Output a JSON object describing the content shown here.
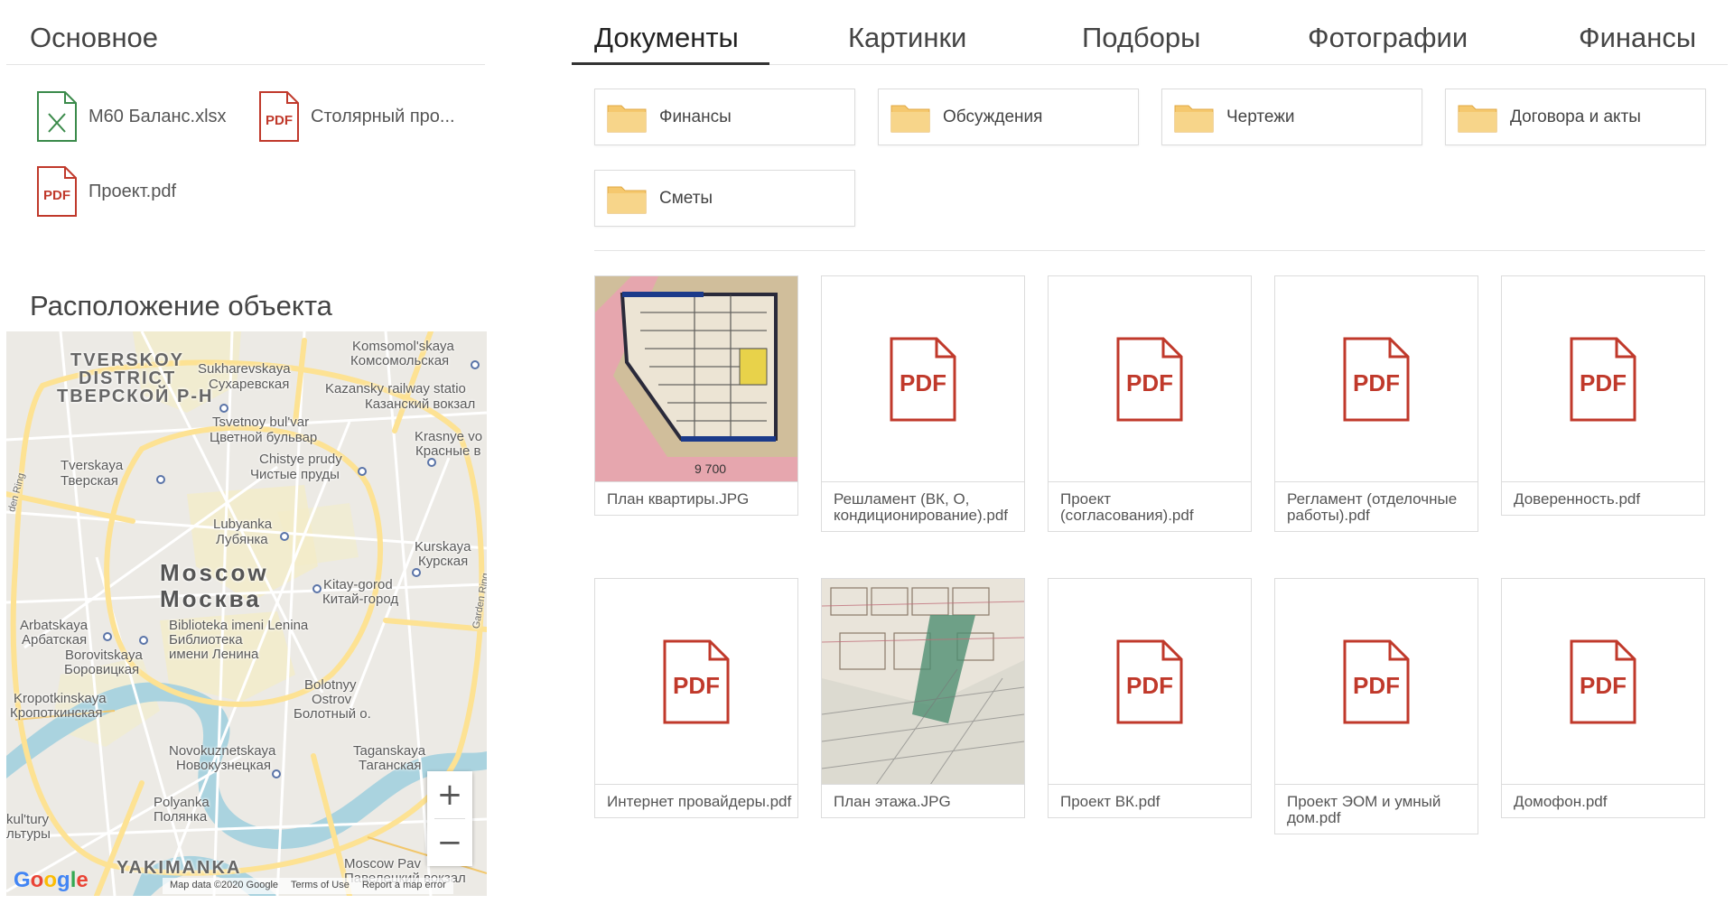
{
  "left": {
    "main_title": "Основное",
    "quick_files": [
      {
        "name": "М60 Баланс.xlsx",
        "type": "xlsx",
        "badge": ""
      },
      {
        "name": "Столярный про...",
        "type": "pdf",
        "badge": "PDF"
      },
      {
        "name": "Проект.pdf",
        "type": "pdf",
        "badge": "PDF"
      }
    ],
    "location_title": "Расположение объекта"
  },
  "map": {
    "labels": [
      {
        "text": "TVERSKOY",
        "kind": "district"
      },
      {
        "text": "DISTRICT",
        "kind": "district"
      },
      {
        "text": "ТВЕРСКОЙ Р-Н",
        "kind": "district"
      },
      {
        "text": "Sukharevskaya",
        "kind": "station"
      },
      {
        "text": "Сухаревская",
        "kind": "station"
      },
      {
        "text": "Komsomol'skaya",
        "kind": "station"
      },
      {
        "text": "Комсомольская",
        "kind": "station"
      },
      {
        "text": "Kazansky railway statio",
        "kind": "station"
      },
      {
        "text": "Казанский вокзал",
        "kind": "station"
      },
      {
        "text": "Tsvetnoy bul'var",
        "kind": "station"
      },
      {
        "text": "Цветной бульвар",
        "kind": "station"
      },
      {
        "text": "Chistye prudy",
        "kind": "station"
      },
      {
        "text": "Чистые пруды",
        "kind": "station"
      },
      {
        "text": "Krasnye vo",
        "kind": "station"
      },
      {
        "text": "Красные в",
        "kind": "station"
      },
      {
        "text": "Tverskaya",
        "kind": "station"
      },
      {
        "text": "Тверская",
        "kind": "station"
      },
      {
        "text": "Lubyanka",
        "kind": "station"
      },
      {
        "text": "Лубянка",
        "kind": "station"
      },
      {
        "text": "Kurskaya",
        "kind": "station"
      },
      {
        "text": "Курская",
        "kind": "station"
      },
      {
        "text": "Moscow",
        "kind": "city"
      },
      {
        "text": "Москва",
        "kind": "city"
      },
      {
        "text": "Kitay-gorod",
        "kind": "station"
      },
      {
        "text": "Китай-город",
        "kind": "station"
      },
      {
        "text": "Arbatskaya",
        "kind": "station"
      },
      {
        "text": "Арбатская",
        "kind": "station"
      },
      {
        "text": "Biblioteka imeni Lenina",
        "kind": "station"
      },
      {
        "text": "Библиотека",
        "kind": "station"
      },
      {
        "text": "имени Ленина",
        "kind": "station"
      },
      {
        "text": "Borovitskaya",
        "kind": "station"
      },
      {
        "text": "Боровицкая",
        "kind": "station"
      },
      {
        "text": "Kropotkinskaya",
        "kind": "station"
      },
      {
        "text": "Кропоткинская",
        "kind": "station"
      },
      {
        "text": "Bolotnyy",
        "kind": "place"
      },
      {
        "text": "Ostrov",
        "kind": "place"
      },
      {
        "text": "Болотный о.",
        "kind": "place"
      },
      {
        "text": "Novokuznetskaya",
        "kind": "station"
      },
      {
        "text": "Новокузнецкая",
        "kind": "station"
      },
      {
        "text": "Taganskaya",
        "kind": "station"
      },
      {
        "text": "Таганская",
        "kind": "station"
      },
      {
        "text": "Polyanka",
        "kind": "station"
      },
      {
        "text": "Полянка",
        "kind": "station"
      },
      {
        "text": "YAKIMANKA",
        "kind": "district"
      },
      {
        "text": "Moscow Pav",
        "kind": "station"
      },
      {
        "text": "Павелецкий вокзал",
        "kind": "station"
      },
      {
        "text": "Garden Ring",
        "kind": "road"
      },
      {
        "text": "den Ring",
        "kind": "road"
      },
      {
        "text": "kul'tury",
        "kind": "station"
      },
      {
        "text": "льтуры",
        "kind": "station"
      }
    ],
    "zoom_in": "+",
    "zoom_out": "−",
    "google": [
      "G",
      "o",
      "o",
      "g",
      "l",
      "e"
    ],
    "footer": [
      "Map data ©2020 Google",
      "Terms of Use",
      "Report a map error"
    ],
    "colors": {
      "water": "#aad3df",
      "park": "#f4ecc8",
      "road": "#ffffff",
      "major_road": "#fde293"
    }
  },
  "tabs": [
    "Документы",
    "Картинки",
    "Подборы",
    "Фотографии",
    "Финансы"
  ],
  "active_tab": "Документы",
  "folders": [
    "Финансы",
    "Обсуждения",
    "Чертежи",
    "Договора и акты",
    "Сметы"
  ],
  "documents": [
    {
      "name": "План квартиры.JPG",
      "type": "image",
      "badge": ""
    },
    {
      "name": "Решламент (ВК, О, кондиционирование).pdf",
      "type": "pdf",
      "badge": "PDF"
    },
    {
      "name": "Проект (согласования).pdf",
      "type": "pdf",
      "badge": "PDF"
    },
    {
      "name": "Регламент (отделочные работы).pdf",
      "type": "pdf",
      "badge": "PDF"
    },
    {
      "name": "Доверенность.pdf",
      "type": "pdf",
      "badge": "PDF"
    },
    {
      "name": "Интернет провайдеры.pdf",
      "type": "pdf",
      "badge": "PDF"
    },
    {
      "name": "План этажа.JPG",
      "type": "image",
      "badge": ""
    },
    {
      "name": "Проект ВК.pdf",
      "type": "pdf",
      "badge": "PDF"
    },
    {
      "name": "Проект ЭОМ и умный дом.pdf",
      "type": "pdf",
      "badge": "PDF"
    },
    {
      "name": "Домофон.pdf",
      "type": "pdf",
      "badge": "PDF"
    }
  ],
  "thumb_labels": {
    "plan_dimension": "9 700"
  },
  "colors": {
    "pdf_red": "#c0392b",
    "xlsx_green": "#3a8a4a",
    "folder": "#f5c86e",
    "folder_dark": "#e9b54e",
    "tab_active": "#333333"
  }
}
